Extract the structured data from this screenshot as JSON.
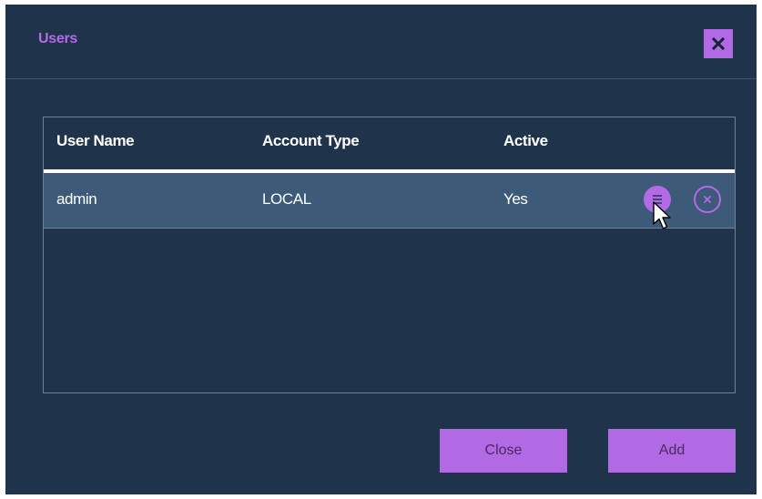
{
  "dialog": {
    "title": "Users",
    "close_icon": "close-icon"
  },
  "table": {
    "columns": [
      "User Name",
      "Account Type",
      "Active"
    ],
    "rows": [
      {
        "user_name": "admin",
        "account_type": "LOCAL",
        "active": "Yes"
      }
    ],
    "row_actions": [
      "menu-icon",
      "remove-circle-icon"
    ]
  },
  "footer": {
    "close_label": "Close",
    "add_label": "Add"
  },
  "colors": {
    "dialog_bg": "#1f344a",
    "accent": "#b16ae4",
    "selected_row": "#3d5a79",
    "header_text": "#ffffff"
  }
}
